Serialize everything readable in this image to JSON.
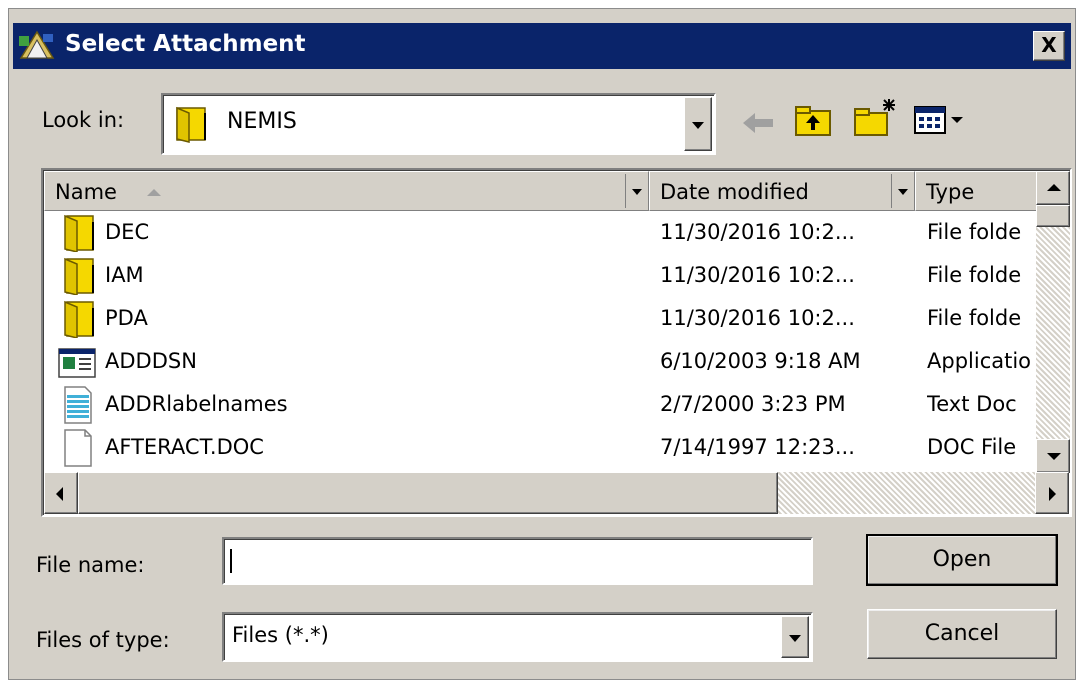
{
  "window": {
    "title": "Select Attachment",
    "close_label": "X"
  },
  "look_in": {
    "label": "Look in:",
    "value": "NEMIS"
  },
  "toolbar": {
    "icons": [
      "back-arrow-icon",
      "up-one-level-icon",
      "new-folder-icon",
      "view-menu-icon"
    ]
  },
  "file_list": {
    "columns": [
      {
        "label": "Name"
      },
      {
        "label": "Date modified"
      },
      {
        "label": "Type"
      }
    ],
    "rows": [
      {
        "name": "DEC",
        "date": "11/30/2016 10:2...",
        "type": "File folde",
        "icon": "folder"
      },
      {
        "name": "IAM",
        "date": "11/30/2016 10:2...",
        "type": "File folde",
        "icon": "folder"
      },
      {
        "name": "PDA",
        "date": "11/30/2016 10:2...",
        "type": "File folde",
        "icon": "folder"
      },
      {
        "name": "ADDDSN",
        "date": "6/10/2003 9:18 AM",
        "type": "Applicatio",
        "icon": "application"
      },
      {
        "name": "ADDRlabelnames",
        "date": "2/7/2000 3:23 PM",
        "type": "Text Doc",
        "icon": "text-document"
      },
      {
        "name": "AFTERACT.DOC",
        "date": "7/14/1997 12:23...",
        "type": "DOC File",
        "icon": "blank-document"
      }
    ]
  },
  "form": {
    "file_name_label": "File name:",
    "file_name_value": "",
    "files_of_type_label": "Files of type:",
    "files_of_type_value": "Files (*.*)"
  },
  "buttons": {
    "open": "Open",
    "cancel": "Cancel"
  },
  "colors": {
    "titlebar": "#0a246a",
    "face": "#d4d0c8",
    "folder": "#f5d800"
  }
}
